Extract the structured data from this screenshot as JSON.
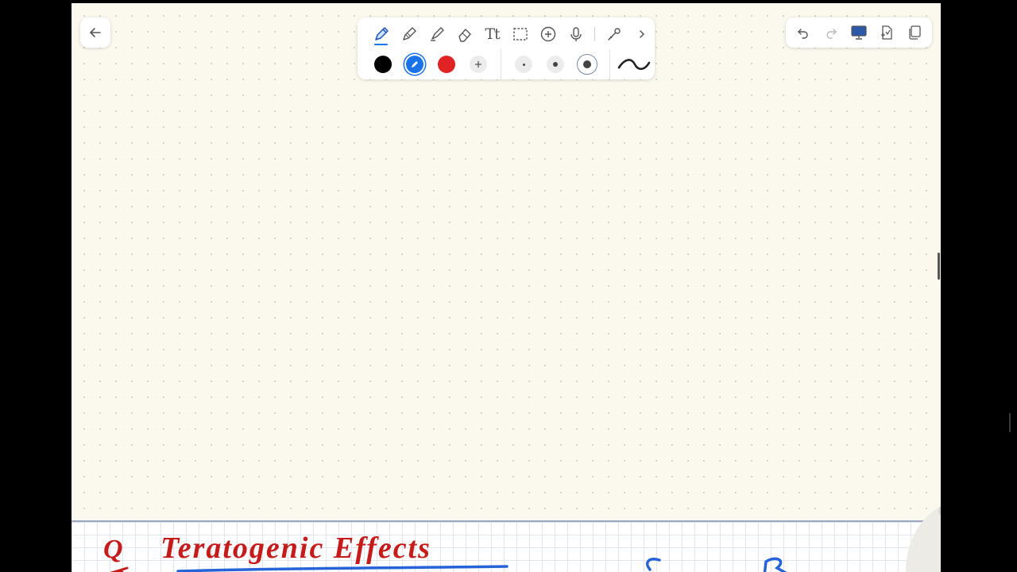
{
  "toolbar": {
    "tools": [
      {
        "name": "pen-icon",
        "active": true
      },
      {
        "name": "pencil-icon",
        "active": false
      },
      {
        "name": "highlighter-icon",
        "active": false
      },
      {
        "name": "eraser-icon",
        "active": false
      },
      {
        "name": "text-icon",
        "active": false
      },
      {
        "name": "lasso-select-icon",
        "active": false
      },
      {
        "name": "add-icon",
        "active": false
      },
      {
        "name": "microphone-icon",
        "active": false
      },
      {
        "name": "laser-pointer-icon",
        "active": false
      },
      {
        "name": "chevron-right-icon",
        "active": false
      }
    ],
    "text_tool_label": "Tt",
    "colors": [
      "#000000",
      "#1a73e8",
      "#e02424"
    ],
    "selected_color": "#1a73e8",
    "stroke_sizes": [
      "small",
      "medium",
      "large"
    ],
    "selected_size": "large"
  },
  "handwriting": {
    "line1_prefix": "Q",
    "line1_title": "Teratogenic Effects"
  },
  "header_right": {
    "icons": [
      "undo-icon",
      "redo-icon",
      "present-icon",
      "page-add-icon",
      "pages-icon"
    ]
  }
}
